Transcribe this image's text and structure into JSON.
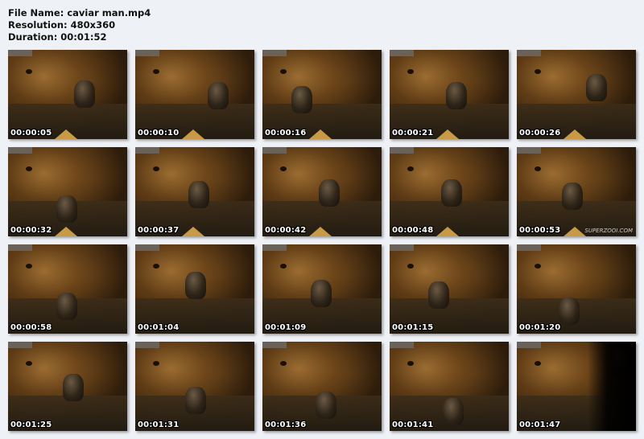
{
  "file_info": {
    "file_name": "File Name: caviar man.mp4",
    "resolution": "Resolution: 480x360",
    "duration": "Duration: 00:01:52"
  },
  "thumbnails": [
    {
      "timestamp": "00:00:05"
    },
    {
      "timestamp": "00:00:10"
    },
    {
      "timestamp": "00:00:16"
    },
    {
      "timestamp": "00:00:21"
    },
    {
      "timestamp": "00:00:26"
    },
    {
      "timestamp": "00:00:32"
    },
    {
      "timestamp": "00:00:37"
    },
    {
      "timestamp": "00:00:42"
    },
    {
      "timestamp": "00:00:48"
    },
    {
      "timestamp": "00:00:53",
      "watermark": "SUPERZOOI.COM"
    },
    {
      "timestamp": "00:00:58"
    },
    {
      "timestamp": "00:01:04"
    },
    {
      "timestamp": "00:01:09"
    },
    {
      "timestamp": "00:01:15"
    },
    {
      "timestamp": "00:01:20"
    },
    {
      "timestamp": "00:01:25"
    },
    {
      "timestamp": "00:01:31"
    },
    {
      "timestamp": "00:01:36"
    },
    {
      "timestamp": "00:01:41"
    },
    {
      "timestamp": "00:01:47"
    }
  ],
  "colors": {
    "background": "#eef1f6",
    "timestamp_text": "#ffffff"
  }
}
